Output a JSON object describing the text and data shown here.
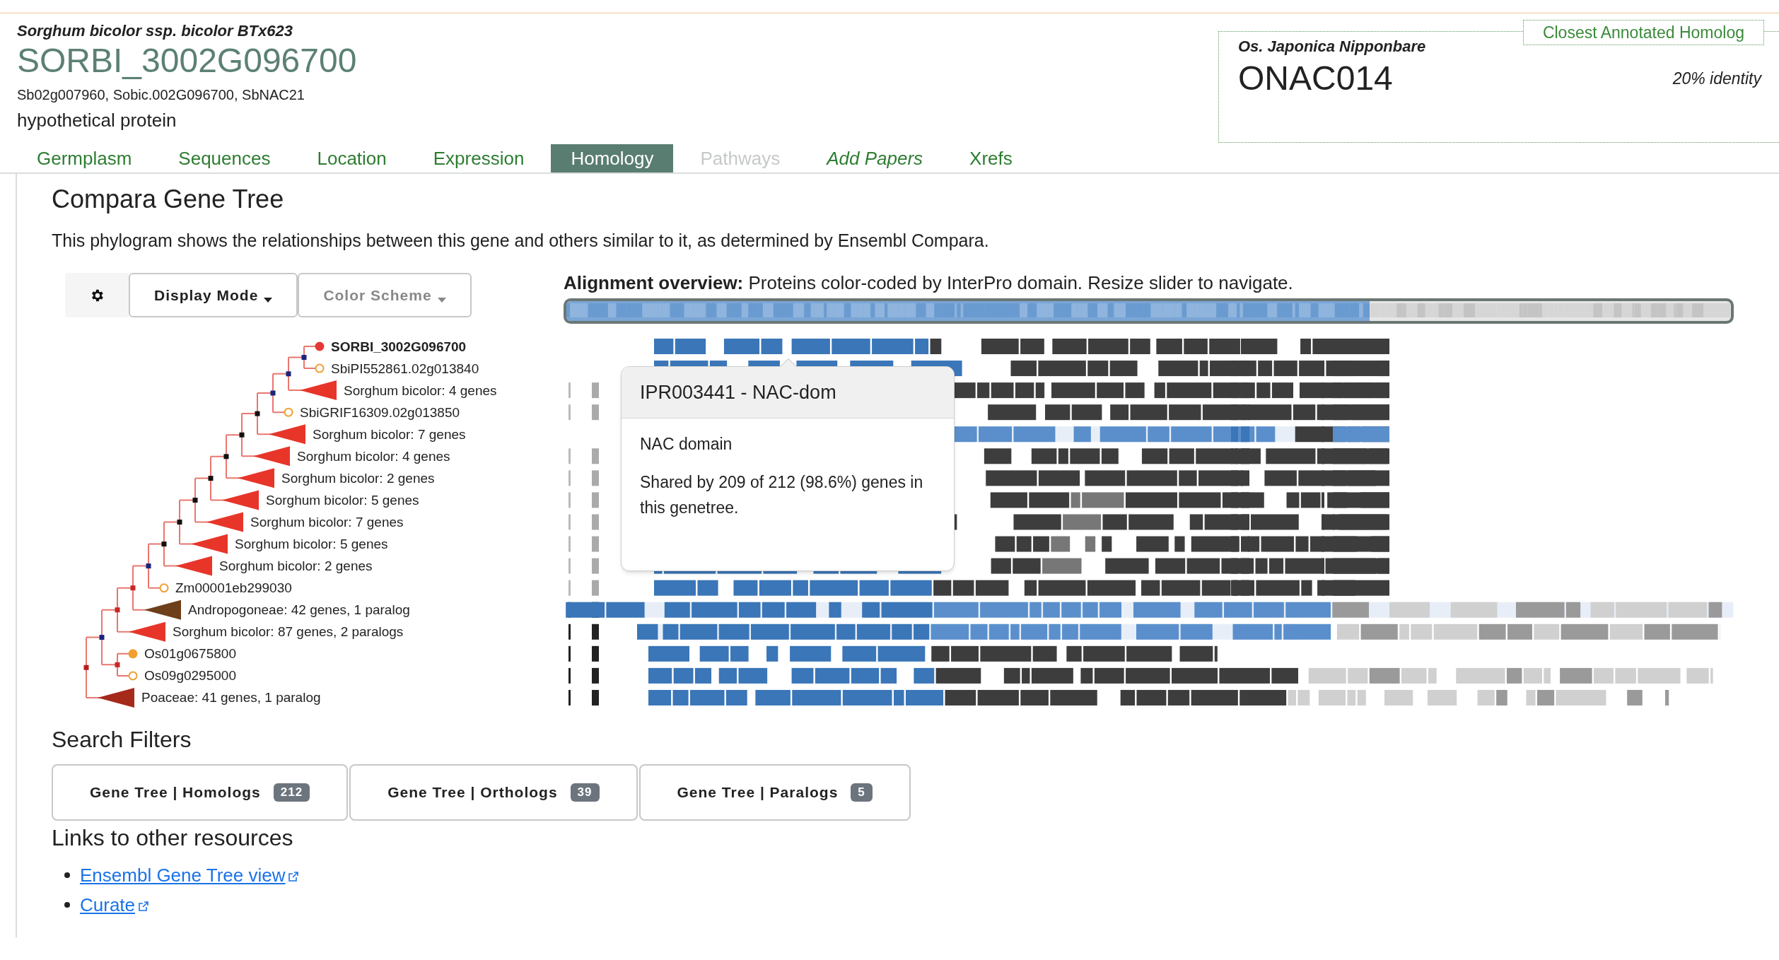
{
  "header": {
    "species": "Sorghum bicolor ssp. bicolor BTx623",
    "gene_id": "SORBI_3002G096700",
    "synonyms": "Sb02g007960, Sobic.002G096700, SbNAC21",
    "description": "hypothetical protein"
  },
  "closest_homolog": {
    "legend": "Closest Annotated Homolog",
    "species": "Os. Japonica Nipponbare",
    "gene": "ONAC014",
    "identity": "20% identity"
  },
  "tabs": [
    {
      "label": "Germplasm",
      "kind": "tab",
      "selected": false,
      "disabled": false
    },
    {
      "label": "Sequences",
      "kind": "tab",
      "selected": false,
      "disabled": false
    },
    {
      "label": "Location",
      "kind": "tab",
      "selected": false,
      "disabled": false
    },
    {
      "label": "Expression",
      "kind": "tab",
      "selected": false,
      "disabled": false
    },
    {
      "label": "Homology",
      "kind": "tab",
      "selected": true,
      "disabled": false
    },
    {
      "label": "Pathways",
      "kind": "tab",
      "selected": false,
      "disabled": true
    },
    {
      "label": "Add Papers",
      "kind": "action",
      "selected": false,
      "disabled": false
    },
    {
      "label": "Xrefs",
      "kind": "tab",
      "selected": false,
      "disabled": false
    }
  ],
  "section": {
    "title": "Compara Gene Tree",
    "description": "This phylogram shows the relationships between this gene and others similar to it, as determined by Ensembl Compara."
  },
  "toolbar": [
    {
      "kind": "settings",
      "disabled": false
    },
    {
      "kind": "dropdown",
      "label": "Display Mode",
      "disabled": false
    },
    {
      "kind": "dropdown",
      "label": "Color Scheme",
      "disabled": true
    }
  ],
  "tree": {
    "color": "#b71c1c",
    "children": [
      {
        "color": "#1a237e",
        "children": [
          {
            "color": "#c62828",
            "children": [
              {
                "color": "#c62828",
                "children": [
                  {
                    "color": "#1a237e",
                    "children": [
                      {
                        "color": "#111111",
                        "children": [
                          {
                            "color": "#111111",
                            "children": [
                              {
                                "color": "#111111",
                                "children": [
                                  {
                                    "color": "#111111",
                                    "children": [
                                      {
                                        "color": "#111111",
                                        "children": [
                                          {
                                            "color": "#111111",
                                            "children": [
                                              {
                                                "color": "#111111",
                                                "children": [
                                                  {
                                                    "color": "#1a237e",
                                                    "children": [
                                                      {
                                                        "color": "#1a237e",
                                                        "children": [
                                                          {
                                                            "color": "#1a237e",
                                                            "children": [
                                                              {
                                                                "kind": "gene",
                                                                "label": "SORBI_3002G096700",
                                                                "color": "#e53935",
                                                                "filled": true,
                                                                "current": true
                                                              },
                                                              {
                                                                "kind": "gene",
                                                                "label": "SbiPI552861.02g013840",
                                                                "color": "#f0a030",
                                                                "filled": false,
                                                                "current": false
                                                              }
                                                            ]
                                                          },
                                                          {
                                                            "kind": "collapsed",
                                                            "label": "Sorghum bicolor: 4 genes",
                                                            "color": "#e8352a"
                                                          }
                                                        ]
                                                      },
                                                      {
                                                        "kind": "gene",
                                                        "label": "SbiGRIF16309.02g013850",
                                                        "color": "#f0a030",
                                                        "filled": false,
                                                        "current": false
                                                      }
                                                    ]
                                                  },
                                                  {
                                                    "kind": "collapsed",
                                                    "label": "Sorghum bicolor: 7 genes",
                                                    "color": "#e8352a"
                                                  }
                                                ]
                                              },
                                              {
                                                "kind": "collapsed",
                                                "label": "Sorghum bicolor: 4 genes",
                                                "color": "#e8352a"
                                              }
                                            ]
                                          },
                                          {
                                            "kind": "collapsed",
                                            "label": "Sorghum bicolor: 2 genes",
                                            "color": "#e8352a"
                                          }
                                        ]
                                      },
                                      {
                                        "kind": "collapsed",
                                        "label": "Sorghum bicolor: 5 genes",
                                        "color": "#e8352a"
                                      }
                                    ]
                                  },
                                  {
                                    "kind": "collapsed",
                                    "label": "Sorghum bicolor: 7 genes",
                                    "color": "#e8352a"
                                  }
                                ]
                              },
                              {
                                "kind": "collapsed",
                                "label": "Sorghum bicolor: 5 genes",
                                "color": "#e8352a"
                              }
                            ]
                          },
                          {
                            "kind": "collapsed",
                            "label": "Sorghum bicolor: 2 genes",
                            "color": "#e8352a"
                          }
                        ]
                      },
                      {
                        "kind": "gene",
                        "label": "Zm00001eb299030",
                        "color": "#f0a030",
                        "filled": false,
                        "current": false
                      }
                    ]
                  },
                  {
                    "kind": "collapsed",
                    "label": "Andropogoneae: 42 genes, 1 paralog",
                    "color": "#6d3f1a"
                  }
                ]
              },
              {
                "kind": "collapsed",
                "label": "Sorghum bicolor: 87 genes, 2 paralogs",
                "color": "#e8352a"
              }
            ]
          },
          {
            "color": "#c62828",
            "children": [
              {
                "kind": "gene",
                "label": "Os01g0675800",
                "color": "#f0a030",
                "filled": true,
                "current": false
              },
              {
                "kind": "gene",
                "label": "Os09g0295000",
                "color": "#f0a030",
                "filled": false,
                "current": false
              }
            ]
          }
        ]
      },
      {
        "kind": "collapsed",
        "label": "Poaceae: 41 genes, 1 paralog",
        "color": "#a52a1a"
      }
    ]
  },
  "alignment": {
    "title": "Alignment overview:",
    "slider": {
      "level": 0.69
    },
    "description": "Proteins color-coded by InterPro domain. Resize slider to navigate.",
    "tooltip": {
      "title": "IPR003441 - NAC-dom",
      "name": "NAC domain",
      "shared": "Shared by 209 of 212 (98.6%) genes in this genetree."
    }
  },
  "search_filters": {
    "title": "Search Filters",
    "buttons": [
      {
        "label": "Gene Tree | Homologs",
        "count": "212"
      },
      {
        "label": "Gene Tree | Orthologs",
        "count": "39"
      },
      {
        "label": "Gene Tree | Paralogs",
        "count": "5"
      }
    ]
  },
  "links": {
    "title": "Links to other resources",
    "items": [
      "Ensembl Gene Tree view",
      "Curate"
    ]
  }
}
